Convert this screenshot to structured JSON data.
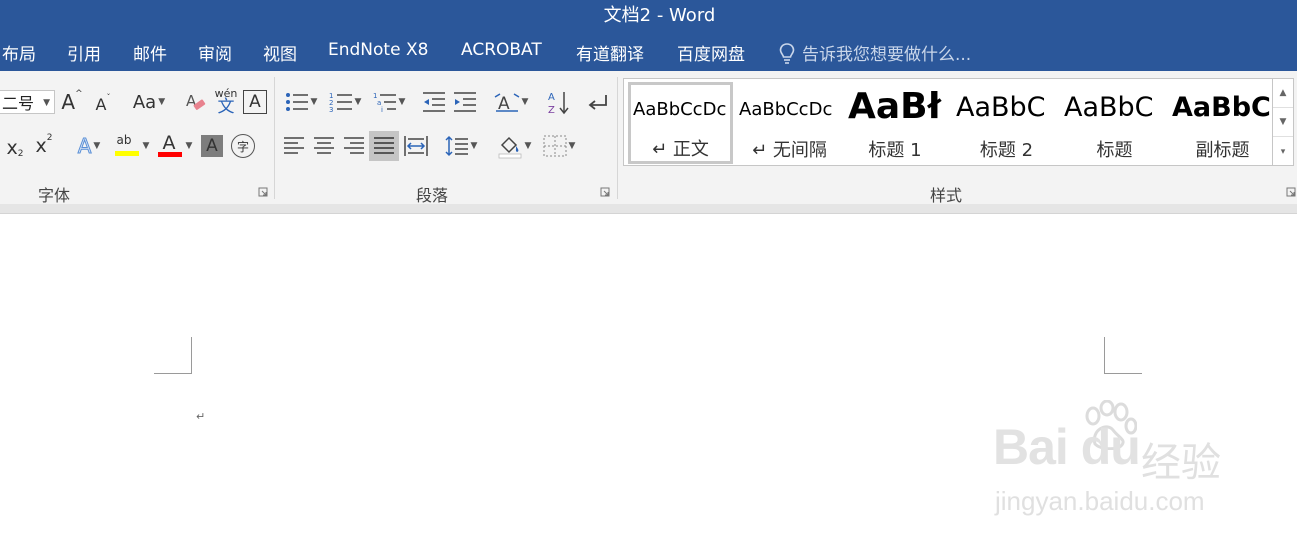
{
  "window": {
    "title": "文档2 - Word"
  },
  "menu": {
    "items": [
      "布局",
      "引用",
      "邮件",
      "审阅",
      "视图",
      "EndNote X8",
      "ACROBAT",
      "有道翻译",
      "百度网盘"
    ],
    "tell_me": "告诉我您想要做什么..."
  },
  "font_group": {
    "label": "字体",
    "size_value": "二号",
    "grow": "A",
    "shrink": "A",
    "change_case": "Aa",
    "phonetic_top": "wén",
    "phonetic_bottom": "文",
    "border_char": "A",
    "subscript_base": "x",
    "subscript_mark": "2",
    "superscript_base": "x",
    "superscript_mark": "2",
    "effects": "A",
    "highlight": "ab",
    "font_color": "A",
    "char_shading": "A",
    "enclose": "字",
    "highlight_color": "#ffff00",
    "font_color_value": "#ff0000"
  },
  "paragraph_group": {
    "label": "段落"
  },
  "styles_group": {
    "label": "样式",
    "items": [
      {
        "sample": "AaBbCcDc",
        "name": "↵ 正文"
      },
      {
        "sample": "AaBbCcDc",
        "name": "↵ 无间隔"
      },
      {
        "sample": "AaBł",
        "name": "标题 1"
      },
      {
        "sample": "AaBbC",
        "name": "标题 2"
      },
      {
        "sample": "AaBbC",
        "name": "标题"
      },
      {
        "sample": "AaBbC",
        "name": "副标题"
      }
    ]
  },
  "document": {
    "paragraph_mark": "↵"
  },
  "watermark": {
    "logo": "Bai du",
    "brand": "经验",
    "url": "jingyan.baidu.com"
  },
  "colors": {
    "ribbon_blue": "#2b579a",
    "ribbon_bg": "#f3f3f3"
  }
}
